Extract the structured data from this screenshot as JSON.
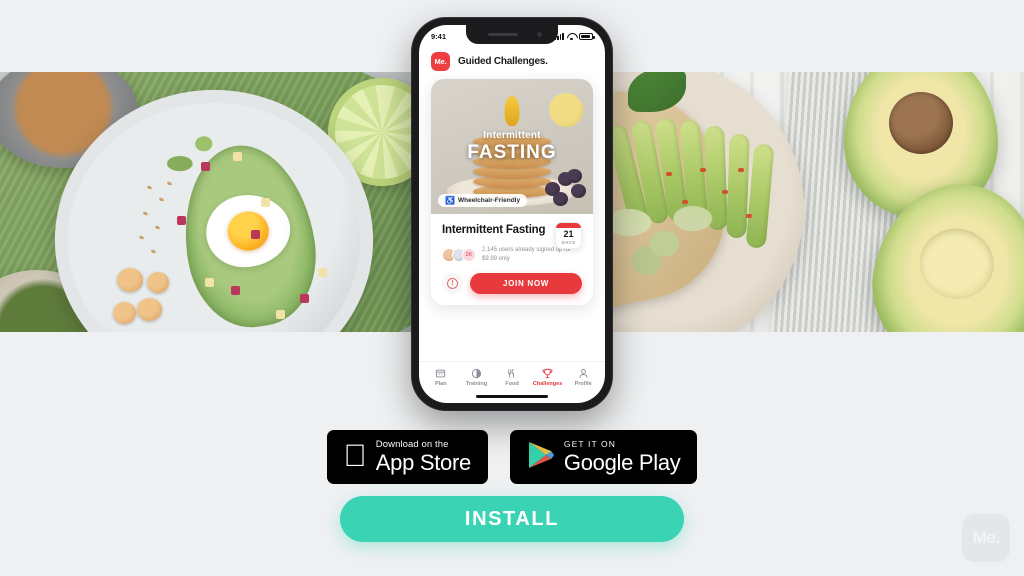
{
  "page": {
    "background_color": "#eef0f2",
    "watermark_label": "Me."
  },
  "hero": {
    "left_photo_alt": "Baked egg in avocado half on a gray plate with greens, beetroot and cheese cubes",
    "right_photo_alt": "Avocado toast with sprouts and chili flakes beside two avocado halves"
  },
  "phone": {
    "status_bar": {
      "time": "9:41",
      "signal_icon": "cellular-bars-icon",
      "wifi_icon": "wifi-icon",
      "battery_icon": "battery-icon"
    },
    "header": {
      "logo_label": "Me.",
      "title": "Guided Challenges."
    },
    "card": {
      "media": {
        "overlay_subtitle": "Intermittent",
        "overlay_title": "FASTING",
        "badge_label": "Wheelchair-Friendly",
        "badge_icon": "accessibility-icon"
      },
      "title": "Intermittent Fasting",
      "days_badge": {
        "number": "21",
        "label": "DAYS"
      },
      "signup_text": "2,145 users already signed up for $9.99 only",
      "avatar_count_label": "2K",
      "info_icon": "info-circle-icon",
      "join_label": "JOIN NOW"
    },
    "tabs": [
      {
        "label": "Plan",
        "icon": "plan-icon",
        "active": false
      },
      {
        "label": "Training",
        "icon": "training-icon",
        "active": false
      },
      {
        "label": "Food",
        "icon": "food-icon",
        "active": false
      },
      {
        "label": "Challenges",
        "icon": "challenges-icon",
        "active": true
      },
      {
        "label": "Profile",
        "icon": "profile-icon",
        "active": false
      }
    ],
    "accent_color": "#e8393d"
  },
  "store_badges": [
    {
      "icon": "apple-logo-icon",
      "small_text": "Download on the",
      "big_text": "App Store"
    },
    {
      "icon": "google-play-icon",
      "small_text": "GET IT ON",
      "big_text": "Google Play"
    }
  ],
  "install": {
    "label": "INSTALL",
    "color": "#3ad4b4"
  }
}
